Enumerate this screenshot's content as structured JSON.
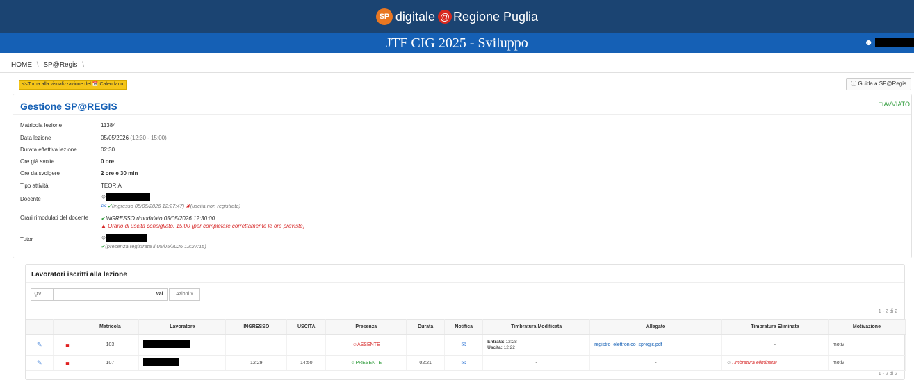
{
  "header": {
    "brand_logo": "SP",
    "brand_text_1": "digitale",
    "brand_at": "@",
    "brand_text_2": "Regione Puglia",
    "title": "JTF CIG 2025 - Sviluppo",
    "user_icon": "user-icon"
  },
  "breadcrumb": {
    "home": "HOME",
    "sep": "\\",
    "current": "SP@Regis"
  },
  "buttons": {
    "back_calendar": "<<Torna alla visualizzazione del 📅 Calendario",
    "guide": "Guida a SP@Regis"
  },
  "lesson": {
    "title": "Gestione SP@REGIS",
    "status": "AVVIATO",
    "fields": {
      "matricola_label": "Matricola lezione",
      "matricola_value": "11384",
      "data_label": "Data lezione",
      "data_value": "05/05/2026",
      "data_time": "(12:30 - 15:00)",
      "durata_label": "Durata effettiva lezione",
      "durata_value": "02:30",
      "svolte_label": "Ore già svolte",
      "svolte_value": "0 ore",
      "dasvolgere_label": "Ore da svolgere",
      "dasvolgere_value": "2 ore e 30 min",
      "tipo_label": "Tipo attività",
      "tipo_value": "TEORIA",
      "docente_label": "Docente",
      "docente_ingresso": "(ingresso 05/05/2026 12:27:47)",
      "docente_uscita": "(uscita non registrata)",
      "orari_label": "Orari rimodulati del docente",
      "orari_ingresso": "INGRESSO rimodulato 05/05/2026 12:30:00",
      "orari_uscita": "Orario di uscita consigliato: 15:00 (per completare correttamente le ore previste)",
      "tutor_label": "Tutor",
      "tutor_presenza": "(presenza registrata il 05/05/2026 12:27:15)"
    }
  },
  "workers": {
    "title": "Lavoratori iscritti alla lezione",
    "vai": "Vai",
    "azioni": "Azioni",
    "pager": "1 - 2 di 2",
    "columns": [
      "",
      "",
      "Matricola",
      "Lavoratore",
      "INGRESSO",
      "USCITA",
      "Presenza",
      "Durata",
      "Notifica",
      "Timbratura Modificata",
      "Allegato",
      "Timbratura Eliminata",
      "Motivazione"
    ],
    "rows": [
      {
        "matricola": "103",
        "ingresso": "",
        "uscita": "",
        "presenza": "ASSENTE",
        "durata": "",
        "timbr_mod_entrata_label": "Entrata:",
        "timbr_mod_entrata": "12:28",
        "timbr_mod_uscita_label": "Uscita:",
        "timbr_mod_uscita": "12:22",
        "allegato": "registro_elettronico_spregis.pdf",
        "timbr_elim": "-",
        "motivazione": "motiv"
      },
      {
        "matricola": "107",
        "ingresso": "12:29",
        "uscita": "14:50",
        "presenza": "PRESENTE",
        "durata": "02:21",
        "timbr_mod": "-",
        "allegato": "-",
        "timbr_elim": "Timbratura eliminata!",
        "motivazione": "motiv"
      }
    ]
  }
}
